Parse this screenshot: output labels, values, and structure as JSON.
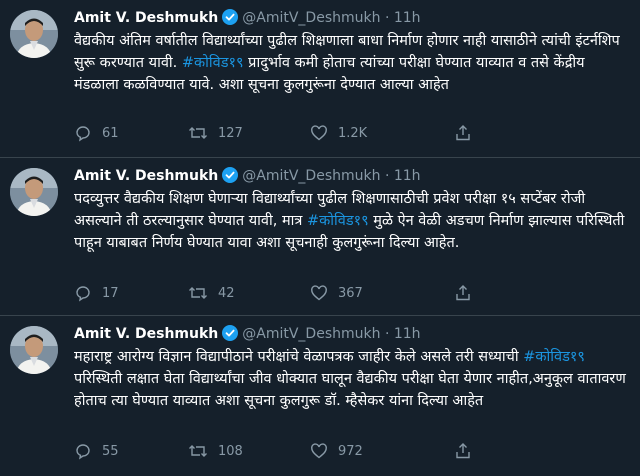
{
  "colors": {
    "background": "#15202b",
    "hashtag": "#1b95e0",
    "muted": "#8899a6",
    "verified": "#1da1f2"
  },
  "tweets": [
    {
      "name": "Amit V. Deshmukh",
      "handle": "@AmitV_Deshmukh",
      "dot": "·",
      "time": "11h",
      "text_a": "वैद्यकीय अंतिम वर्षातील विद्यार्थ्यांच्या पुढील शिक्षणाला बाधा निर्माण होणार नाही यासाठीने त्यांची इंटर्नशिप सुरू करण्यात यावी. ",
      "hashtag": "#कोविड१९",
      "text_b": "  प्रादुर्भाव  कमी होताच  त्यांच्या  परीक्षा घेण्यात याव्यात व तसे केंद्रीय मंडळाला कळविण्यात यावे. अशा सूचना कुलगुरूंना देण्यात आल्या आहेत",
      "replies": "61",
      "retweets": "127",
      "likes": "1.2K"
    },
    {
      "name": "Amit V. Deshmukh",
      "handle": "@AmitV_Deshmukh",
      "dot": "·",
      "time": "11h",
      "text_a": "पदव्युत्तर वैद्यकीय शिक्षण घेणाऱ्या विद्यार्थ्यांच्या पुढील शिक्षणासाठीची प्रवेश परीक्षा १५ सप्टेंबर रोजी असल्याने ती ठरल्यानुसार घेण्यात यावी, मात्र ",
      "hashtag": "#कोविड१९",
      "text_b": " मुळे  ऐन वेळी अडचण निर्माण झाल्यास  परिस्थिती पाहून याबाबत निर्णय घेण्यात यावा  अशा सूचनाही कुलगुरूंना दिल्या आहेत.",
      "replies": "17",
      "retweets": "42",
      "likes": "367"
    },
    {
      "name": "Amit V. Deshmukh",
      "handle": "@AmitV_Deshmukh",
      "dot": "·",
      "time": "11h",
      "text_a": "महाराष्ट्र आरोग्य विज्ञान विद्यापीठाने परीक्षांचे वेळापत्रक जाहीर केले असले तरी सध्याची ",
      "hashtag": "#कोविड१९",
      "text_b": " परिस्थिती लक्षात घेता विद्यार्थ्यांचा जीव धोक्यात घालून वैद्यकीय परीक्षा घेता येणार नाहीत,अनुकूल वातावरण   होताच त्या घेण्यात याव्यात अशा सूचना  कुलगुरू डॉ. म्हैसेकर यांना दिल्या आहेत",
      "replies": "55",
      "retweets": "108",
      "likes": "972"
    }
  ]
}
